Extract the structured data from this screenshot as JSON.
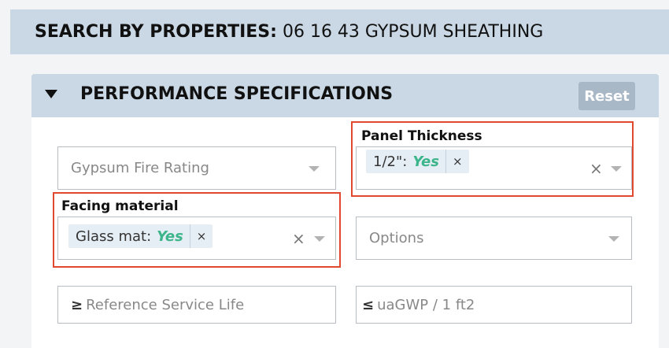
{
  "search_header": {
    "prefix": "SEARCH BY PROPERTIES:",
    "category": "06 16 43 GYPSUM SHEATHING"
  },
  "panel": {
    "title": "PERFORMANCE SPECIFICATIONS",
    "reset_label": "Reset"
  },
  "fields": {
    "fire_rating": {
      "placeholder": "Gypsum Fire Rating"
    },
    "panel_thickness": {
      "label": "Panel Thickness",
      "tag_option": "1/2\":",
      "tag_value": "Yes",
      "tag_remove": "×",
      "clear": "×"
    },
    "facing_material": {
      "label": "Facing material",
      "tag_option": "Glass mat:",
      "tag_value": "Yes",
      "tag_remove": "×",
      "clear": "×"
    },
    "options": {
      "placeholder": "Options"
    },
    "service_life": {
      "symbol": "≥",
      "placeholder": "Reference Service Life"
    },
    "gwp": {
      "symbol": "≤",
      "placeholder": "uaGWP / 1 ft2"
    }
  },
  "colors": {
    "header_bg": "#c9d8e4",
    "highlight": "#e0482f",
    "tag_value": "#3db58a"
  }
}
